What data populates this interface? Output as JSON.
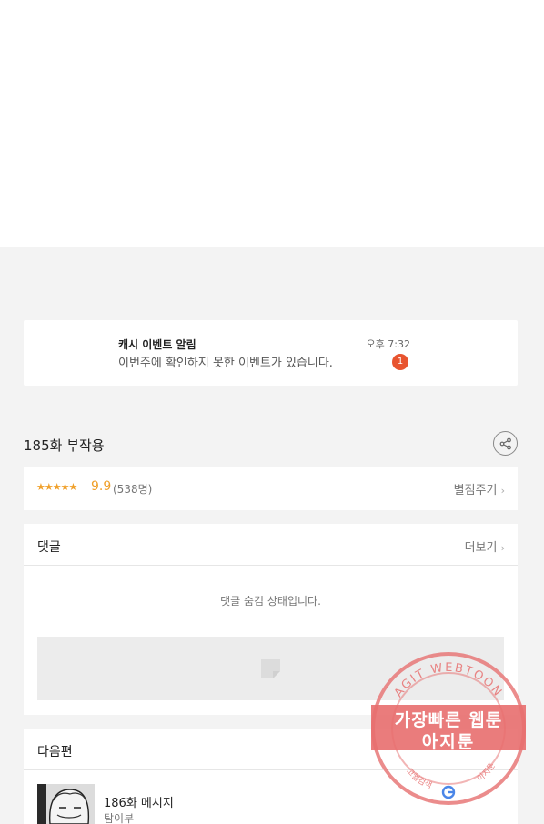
{
  "notification": {
    "title": "캐시 이벤트 알림",
    "message": "이번주에 확인하지 못한 이벤트가 있습니다.",
    "time": "오후 7:32",
    "badge_count": "1"
  },
  "episode": {
    "title": "185화 부작용"
  },
  "rating": {
    "stars": "★★★★★",
    "score": "9.9",
    "votes": "(538명)",
    "rate_button": "별점주기"
  },
  "comments": {
    "heading": "댓글",
    "more": "더보기",
    "hidden_message": "댓글 숨김 상태입니다."
  },
  "next": {
    "heading": "다음편",
    "episode_title": "186화 메시지",
    "subtitle": "탐이부"
  },
  "watermark": {
    "arc_text": "AGIT WEBTOON",
    "line1": "가장빠른 웹툰",
    "line2": "아지툰",
    "small_left": "고퀄검색",
    "small_right": "아지툰"
  },
  "colors": {
    "accent_orange": "#f0a02a",
    "badge_red": "#e8542f",
    "watermark_red": "#e87878"
  }
}
